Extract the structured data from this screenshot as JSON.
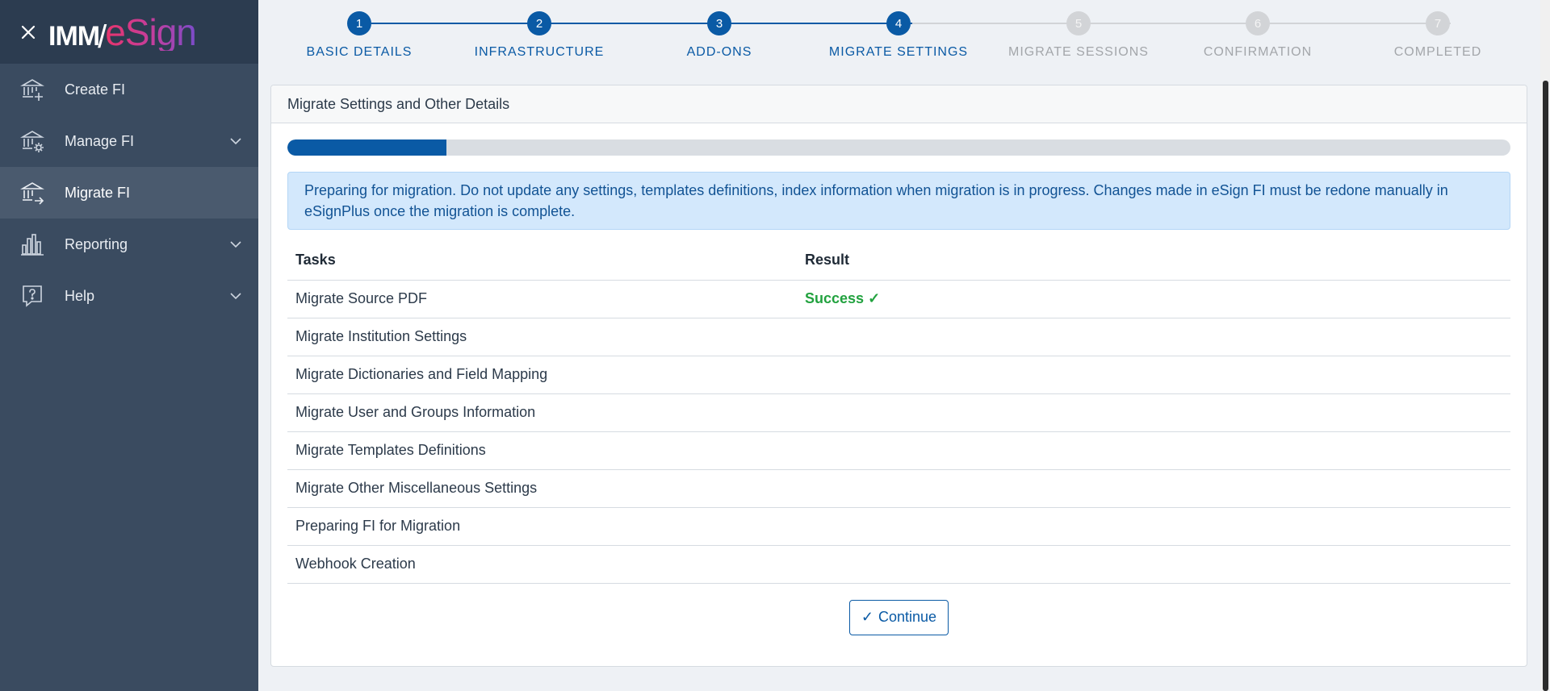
{
  "sidebar": {
    "logo": {
      "imm": "IMM",
      "slash": "/",
      "esign": "eSign"
    },
    "items": [
      {
        "label": "Create FI",
        "icon": "bank-plus-icon",
        "active": false,
        "has_chevron": false
      },
      {
        "label": "Manage FI",
        "icon": "bank-gear-icon",
        "active": false,
        "has_chevron": true
      },
      {
        "label": "Migrate FI",
        "icon": "bank-arrow-icon",
        "active": true,
        "has_chevron": false
      },
      {
        "label": "Reporting",
        "icon": "bar-chart-icon",
        "active": false,
        "has_chevron": true
      },
      {
        "label": "Help",
        "icon": "help-bubble-icon",
        "active": false,
        "has_chevron": true
      }
    ]
  },
  "stepper": {
    "steps": [
      {
        "number": "1",
        "label": "BASIC DETAILS",
        "state": "done"
      },
      {
        "number": "2",
        "label": "INFRASTRUCTURE",
        "state": "done"
      },
      {
        "number": "3",
        "label": "ADD-ONS",
        "state": "done"
      },
      {
        "number": "4",
        "label": "MIGRATE SETTINGS",
        "state": "done"
      },
      {
        "number": "5",
        "label": "MIGRATE SESSIONS",
        "state": "todo"
      },
      {
        "number": "6",
        "label": "CONFIRMATION",
        "state": "todo"
      },
      {
        "number": "7",
        "label": "COMPLETED",
        "state": "todo"
      }
    ]
  },
  "card": {
    "title": "Migrate Settings and Other Details",
    "progress_fraction": 0.13,
    "alert": "Preparing for migration. Do not update any settings, templates definitions, index information when migration is in progress. Changes made in eSign FI must be redone manually in eSignPlus once the migration is complete.",
    "table": {
      "headers": {
        "task": "Tasks",
        "result": "Result"
      },
      "rows": [
        {
          "task": "Migrate Source PDF",
          "result": "Success"
        },
        {
          "task": "Migrate Institution Settings",
          "result": ""
        },
        {
          "task": "Migrate Dictionaries and Field Mapping",
          "result": ""
        },
        {
          "task": "Migrate User and Groups Information",
          "result": ""
        },
        {
          "task": "Migrate Templates Definitions",
          "result": ""
        },
        {
          "task": "Migrate Other Miscellaneous Settings",
          "result": ""
        },
        {
          "task": "Preparing FI for Migration",
          "result": ""
        },
        {
          "task": "Webhook Creation",
          "result": ""
        }
      ]
    },
    "continue_label": "Continue"
  },
  "colors": {
    "sidebar_bg": "#3a4b60",
    "sidebar_header_bg": "#2c3c50",
    "primary": "#0a5aa5",
    "success": "#22a23f",
    "inactive_step": "#d2d4d7",
    "alert_bg": "#d3e8fc"
  }
}
